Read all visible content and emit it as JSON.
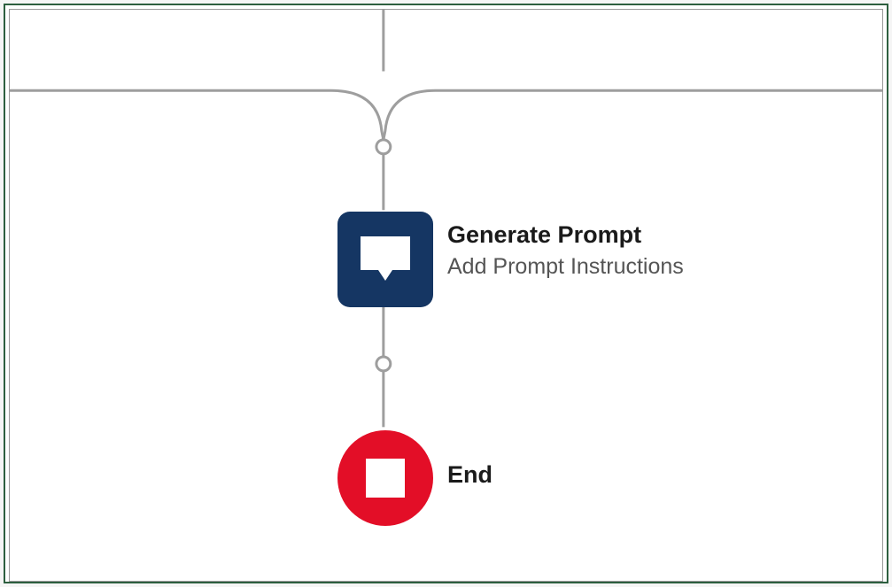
{
  "nodes": {
    "generate_prompt": {
      "title": "Generate Prompt",
      "subtitle": "Add Prompt Instructions"
    },
    "end": {
      "title": "End"
    }
  },
  "colors": {
    "connector": "#9e9e9e",
    "node_navy": "#153663",
    "node_red": "#e30e27",
    "border_green": "#2d5f3f"
  }
}
